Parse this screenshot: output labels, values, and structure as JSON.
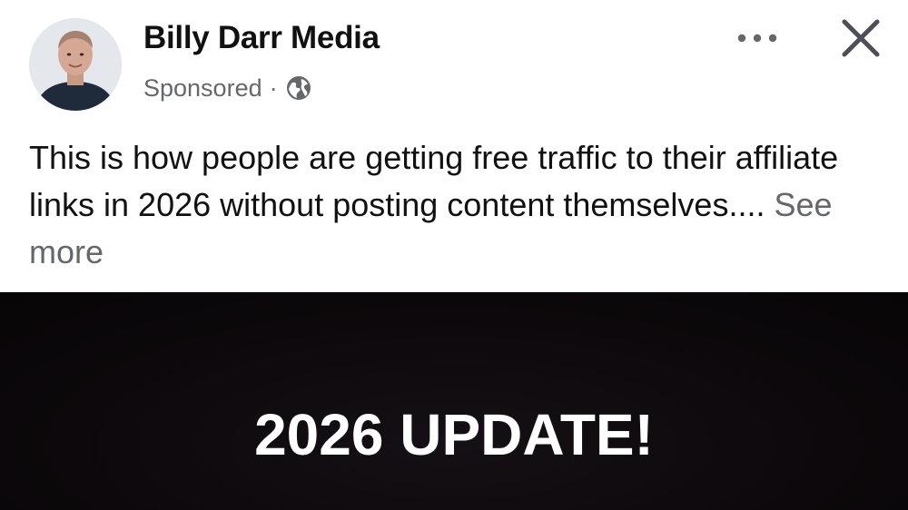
{
  "post": {
    "page_name": "Billy Darr Media",
    "sponsored_label": "Sponsored",
    "separator": "·",
    "audience_icon": "globe-icon",
    "more_icon": "more-options-icon",
    "close_icon": "close-icon",
    "text_body": "This is how people are getting free traffic to their affiliate links in 2026 without posting content themselves....",
    "see_more_label": "See more",
    "media": {
      "headline": "2026 UPDATE!",
      "background_color": "#0c080b"
    }
  },
  "colors": {
    "primary_text": "#111111",
    "secondary_text": "#65676b",
    "background": "#ffffff"
  }
}
